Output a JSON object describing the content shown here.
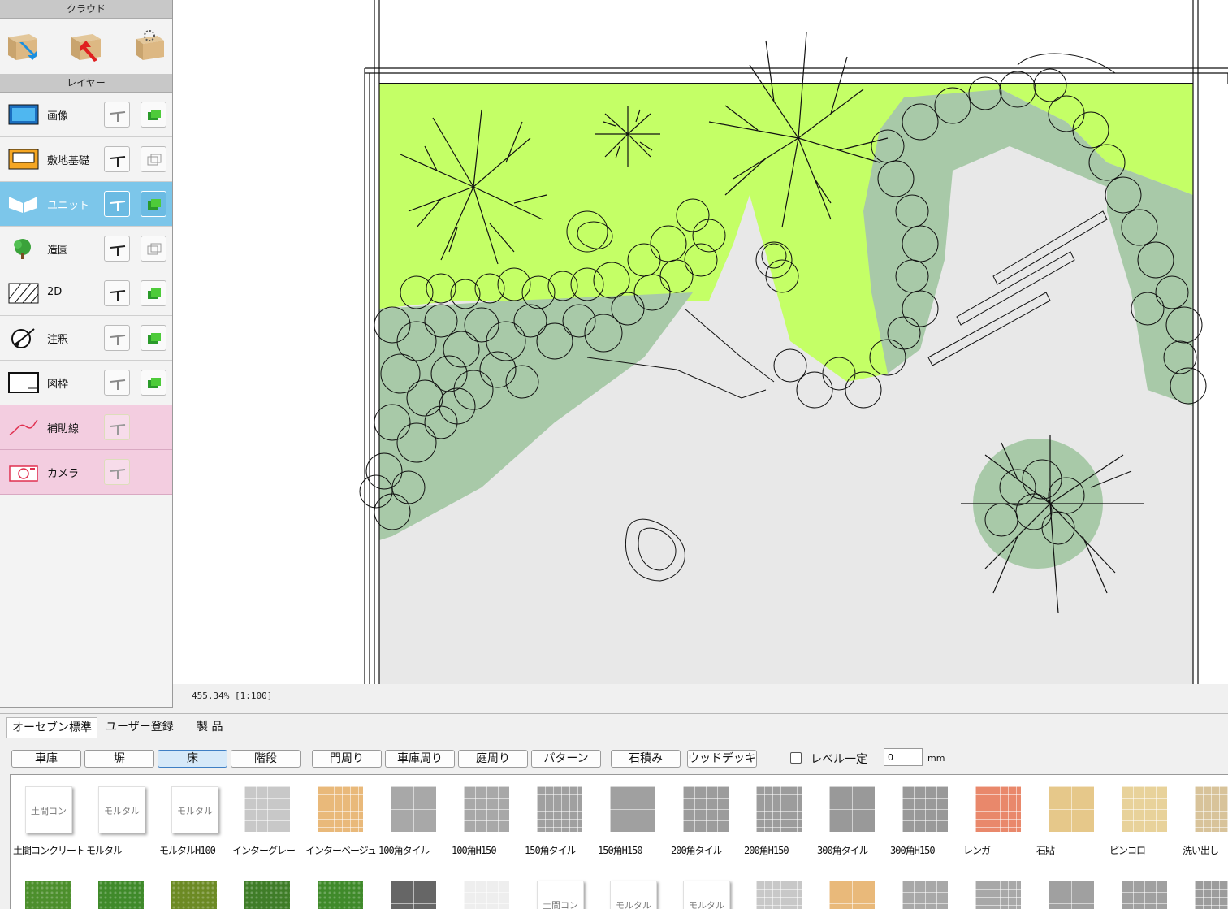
{
  "left_panel": {
    "cloud_header": "クラウド",
    "layer_header": "レイヤー",
    "layers": [
      {
        "label": "画像"
      },
      {
        "label": "敷地基礎"
      },
      {
        "label": "ユニット"
      },
      {
        "label": "造園"
      },
      {
        "label": "2D"
      },
      {
        "label": "注釈"
      },
      {
        "label": "図枠"
      },
      {
        "label": "補助線"
      },
      {
        "label": "カメラ"
      }
    ]
  },
  "canvas": {
    "zoom": "455.34% [1:100]"
  },
  "bottom": {
    "tabs": [
      "オーセブン標準",
      "ユーザー登録",
      "製 品"
    ],
    "categories": [
      "車庫",
      "塀",
      "床",
      "階段",
      "門周り",
      "車庫周り",
      "庭周り",
      "パターン",
      "石積み",
      "ウッドデッキ"
    ],
    "active_category": "床",
    "level_label": "レベル一定",
    "level_value": "0",
    "level_unit": "mm",
    "materials": [
      {
        "label": "土間コンクリート",
        "thumb_text": "土間コン",
        "color": "#ffffff"
      },
      {
        "label": "モルタル",
        "thumb_text": "モルタル",
        "color": "#ffffff"
      },
      {
        "label": "モルタルH100",
        "thumb_text": "モルタル",
        "color": "#ffffff"
      },
      {
        "label": "インターグレー",
        "color": "#c8c8c8"
      },
      {
        "label": "インターベージュ",
        "color": "#e9b97a"
      },
      {
        "label": "100角タイル",
        "color": "#a8a8a8"
      },
      {
        "label": "100角H150",
        "color": "#a8a8a8"
      },
      {
        "label": "150角タイル",
        "color": "#a0a0a0"
      },
      {
        "label": "150角H150",
        "color": "#a0a0a0"
      },
      {
        "label": "200角タイル",
        "color": "#9c9c9c"
      },
      {
        "label": "200角H150",
        "color": "#9c9c9c"
      },
      {
        "label": "300角タイル",
        "color": "#999999"
      },
      {
        "label": "300角H150",
        "color": "#999999"
      },
      {
        "label": "レンガ",
        "color": "#e9886b"
      },
      {
        "label": "石貼",
        "color": "#e6c88a"
      },
      {
        "label": "ピンコロ",
        "color": "#e8d29a"
      },
      {
        "label": "洗い出し",
        "color": "#d8c39a"
      }
    ],
    "materials_row2": [
      {
        "color": "#4c8f2c"
      },
      {
        "color": "#3f8a2a"
      },
      {
        "color": "#6c8a24"
      },
      {
        "color": "#3f7d28"
      },
      {
        "color": "#3f8a2a"
      },
      {
        "color": "#666666"
      },
      {
        "color": "#eeeeee"
      },
      {
        "thumb_text": "土間コン",
        "color": "#ffffff"
      },
      {
        "thumb_text": "モルタル",
        "color": "#ffffff"
      },
      {
        "thumb_text": "モルタル",
        "color": "#ffffff"
      },
      {
        "color": "#c8c8c8"
      },
      {
        "color": "#e9b97a"
      },
      {
        "color": "#a8a8a8"
      },
      {
        "color": "#a8a8a8"
      },
      {
        "color": "#a0a0a0"
      },
      {
        "color": "#a0a0a0"
      },
      {
        "color": "#9c9c9c"
      }
    ]
  }
}
